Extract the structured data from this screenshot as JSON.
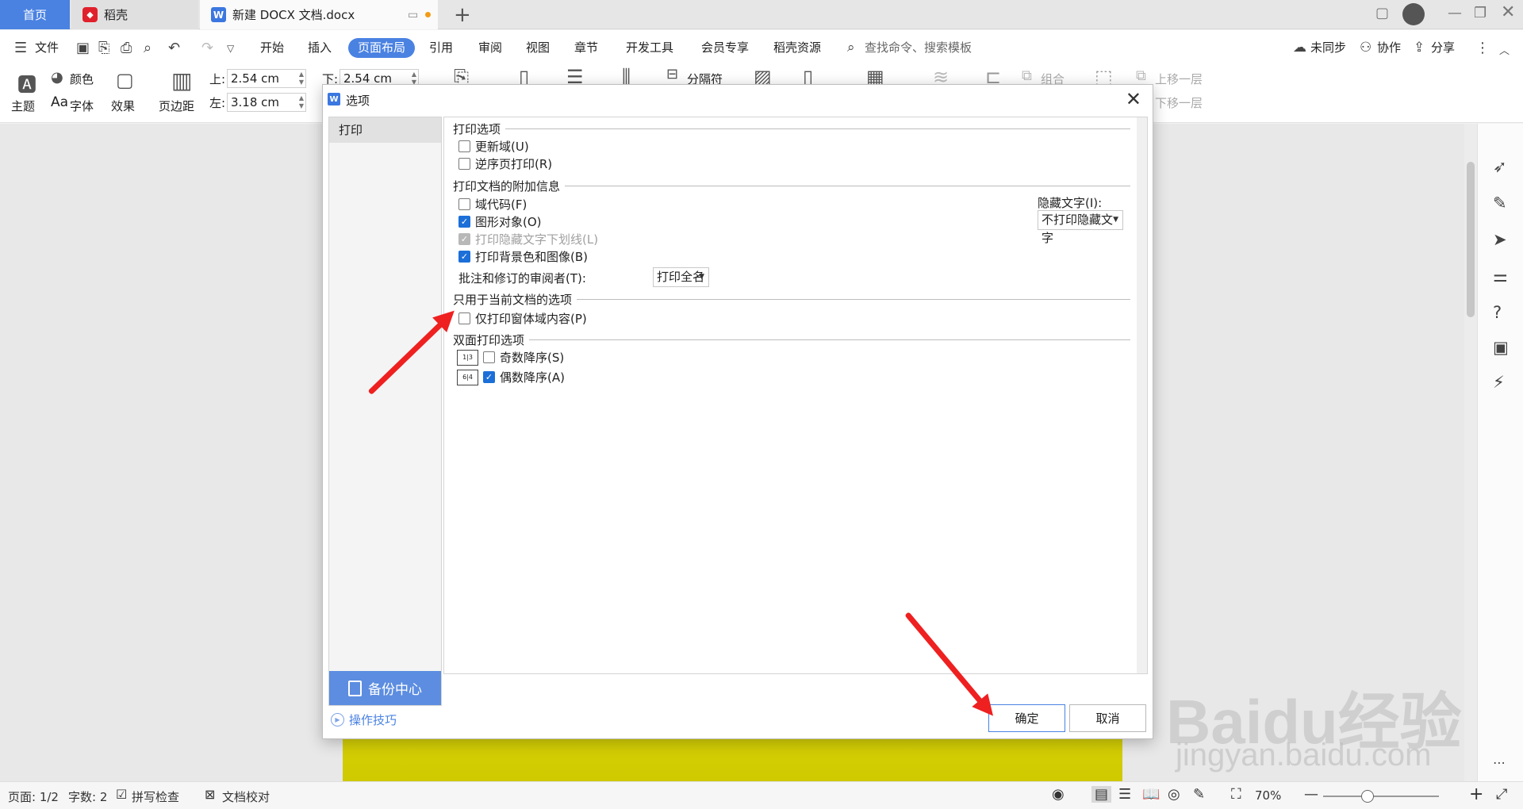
{
  "tabs": {
    "home": "首页",
    "daoke": "稻壳",
    "doc": "新建 DOCX 文档.docx"
  },
  "menubar": {
    "file": "文件",
    "items": [
      "开始",
      "插入",
      "页面布局",
      "引用",
      "审阅",
      "视图",
      "章节",
      "开发工具",
      "会员专享",
      "稻壳资源"
    ],
    "active_index": 2,
    "search": "查找命令、搜索模板",
    "unsynced": "未同步",
    "collab": "协作",
    "share": "分享"
  },
  "ribbon": {
    "theme": "主题",
    "color": "颜色",
    "font": "字体",
    "effect": "效果",
    "margin": "页边距",
    "top_label": "上:",
    "top_value": "2.54 cm",
    "bottom_label": "下:",
    "bottom_value": "2.54 cm",
    "left_label": "左:",
    "left_value": "3.18 cm",
    "separator": "分隔符",
    "group": "组合",
    "bring_forward": "上移一层",
    "send_backward": "下移一层"
  },
  "dialog": {
    "title": "选项",
    "nav_print": "打印",
    "backup_center": "备份中心",
    "tips": "操作技巧",
    "sections": {
      "print_options": "打印选项",
      "doc_extra": "打印文档的附加信息",
      "current_doc": "只用于当前文档的选项",
      "duplex": "双面打印选项"
    },
    "options": {
      "update_fields": "更新域(U)",
      "reverse_order": "逆序页打印(R)",
      "field_codes": "域代码(F)",
      "drawing_objects": "图形对象(O)",
      "hidden_underline": "打印隐藏文字下划线(L)",
      "background": "打印背景色和图像(B)",
      "form_only": "仅打印窗体域内容(P)",
      "odd_desc": "奇数降序(S)",
      "even_desc": "偶数降序(A)"
    },
    "checked": {
      "update_fields": false,
      "reverse_order": false,
      "field_codes": false,
      "drawing_objects": true,
      "hidden_underline": true,
      "background": true,
      "form_only": false,
      "odd_desc": false,
      "even_desc": true
    },
    "hidden_text_label": "隐藏文字(I):",
    "hidden_text_value": "不打印隐藏文字",
    "reviewer_label": "批注和修订的审阅者(T):",
    "reviewer_value": "打印全名",
    "ok": "确定",
    "cancel": "取消"
  },
  "statusbar": {
    "page": "页面: 1/2",
    "words": "字数: 2",
    "spell": "拼写检查",
    "proof": "文档校对",
    "zoom": "70%"
  },
  "watermark": {
    "brand": "Baidu经验",
    "url": "jingyan.baidu.com"
  },
  "colors": {
    "accent": "#4a82e2",
    "checkbox": "#1c6fd8",
    "arrow": "#ef2020",
    "page_yellow": "#d8d40a"
  }
}
